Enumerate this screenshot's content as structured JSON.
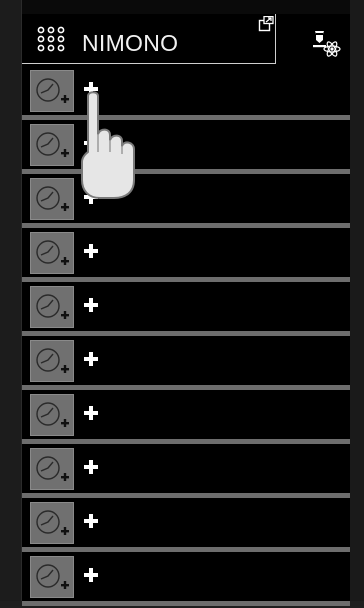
{
  "app": {
    "title": "NIMONO"
  },
  "header": {
    "menu_icon": "grid-menu-icon",
    "export_icon": "export-icon",
    "settings_icon": "lab-settings-icon"
  },
  "list": {
    "rows": [
      {
        "thumb_icon": "clock-add-icon",
        "add_icon": "plus-icon"
      },
      {
        "thumb_icon": "clock-add-icon",
        "add_icon": "plus-icon"
      },
      {
        "thumb_icon": "clock-add-icon",
        "add_icon": "plus-icon"
      },
      {
        "thumb_icon": "clock-add-icon",
        "add_icon": "plus-icon"
      },
      {
        "thumb_icon": "clock-add-icon",
        "add_icon": "plus-icon"
      },
      {
        "thumb_icon": "clock-add-icon",
        "add_icon": "plus-icon"
      },
      {
        "thumb_icon": "clock-add-icon",
        "add_icon": "plus-icon"
      },
      {
        "thumb_icon": "clock-add-icon",
        "add_icon": "plus-icon"
      },
      {
        "thumb_icon": "clock-add-icon",
        "add_icon": "plus-icon"
      },
      {
        "thumb_icon": "clock-add-icon",
        "add_icon": "plus-icon"
      }
    ]
  },
  "overlay": {
    "cursor_icon": "hand-pointer-icon"
  },
  "colors": {
    "background": "#000000",
    "divider": "#6d6d6d",
    "thumb": "#707070",
    "text": "#f2f2f2"
  }
}
